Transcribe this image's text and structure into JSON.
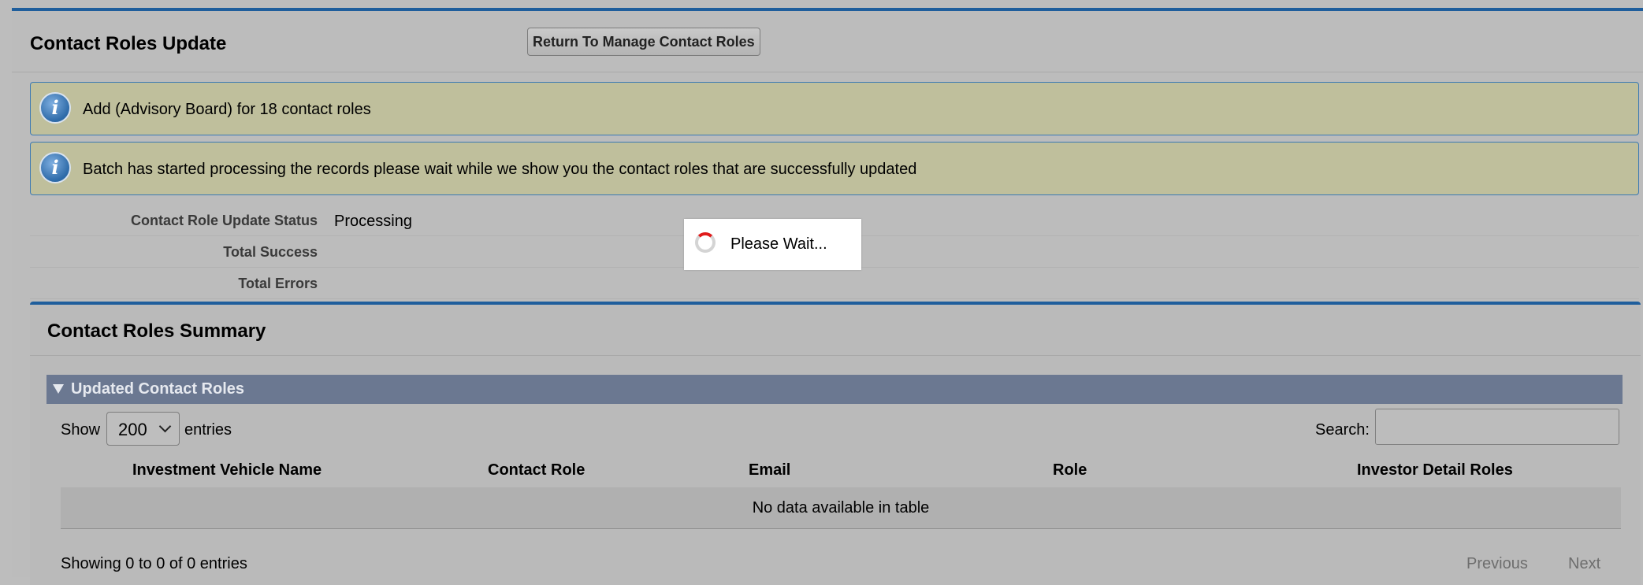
{
  "header": {
    "title": "Contact Roles Update",
    "return_button": "Return To Manage Contact Roles"
  },
  "messages": [
    {
      "icon": "info-icon",
      "text": "Add (Advisory Board) for 18 contact roles"
    },
    {
      "icon": "info-icon",
      "text": "Batch has started processing the records please wait while we show you the contact roles that are successfully updated"
    }
  ],
  "details": [
    {
      "label": "Contact Role Update Status",
      "value": "Processing"
    },
    {
      "label": "Total Success",
      "value": ""
    },
    {
      "label": "Total Errors",
      "value": ""
    }
  ],
  "overlay": {
    "text": "Please Wait..."
  },
  "summary": {
    "title": "Contact Roles Summary",
    "section_title": "Updated Contact Roles",
    "show_label": "Show",
    "show_value": "200",
    "entries_label": "entries",
    "search_label": "Search:",
    "search_value": "",
    "columns": [
      "Investment Vehicle Name",
      "Contact Role",
      "Email",
      "Role",
      "Investor Detail Roles"
    ],
    "empty_text": "No data available in table",
    "info_text": "Showing 0 to 0 of 0 entries",
    "previous_label": "Previous",
    "next_label": "Next"
  },
  "colors": {
    "accent": "#1f5e9c",
    "message_bg": "#bfbf9c",
    "section_bar": "#6b7891",
    "spinner": "#e01b1b"
  }
}
